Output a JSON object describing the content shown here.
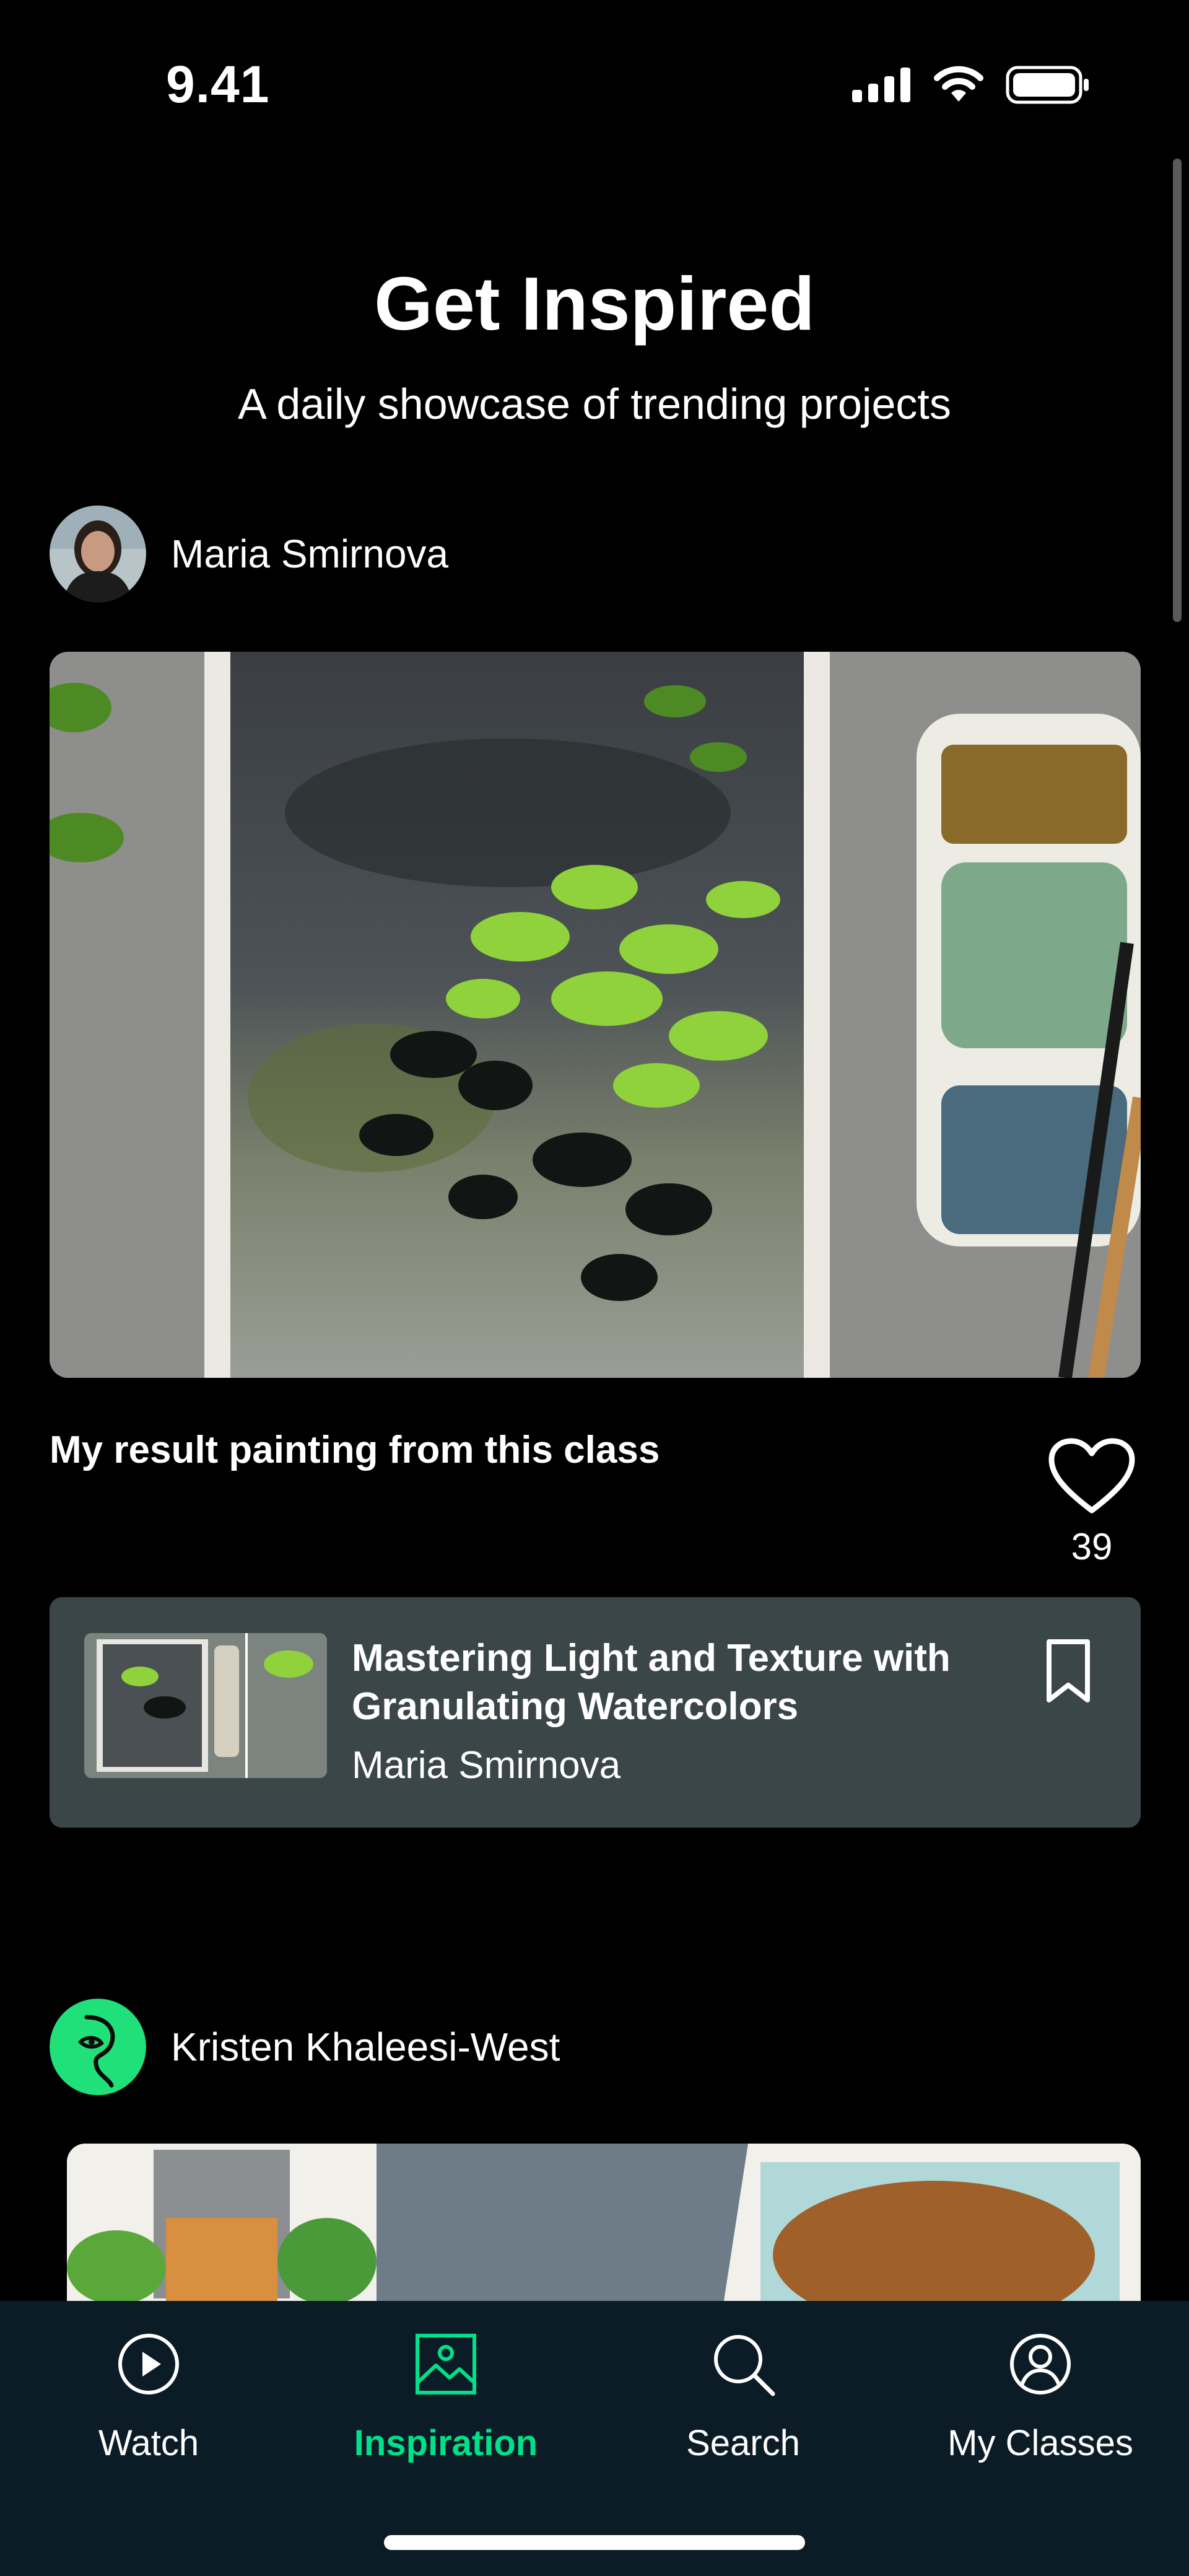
{
  "status_bar": {
    "time": "9.41"
  },
  "header": {
    "title": "Get Inspired",
    "subtitle": "A daily showcase of trending projects"
  },
  "posts": [
    {
      "author": "Maria Smirnova",
      "caption": "My result painting from this class",
      "likes": "39",
      "class": {
        "title": "Mastering Light and Texture with Granulating Watercolors",
        "teacher": "Maria Smirnova"
      }
    },
    {
      "author": "Kristen Khaleesi-West"
    }
  ],
  "tab_bar": {
    "tabs": [
      {
        "label": "Watch",
        "icon": "play-circle-icon",
        "active": false
      },
      {
        "label": "Inspiration",
        "icon": "image-icon",
        "active": true
      },
      {
        "label": "Search",
        "icon": "search-icon",
        "active": false
      },
      {
        "label": "My Classes",
        "icon": "user-circle-icon",
        "active": false
      }
    ]
  },
  "colors": {
    "background": "#000000",
    "accent": "#00e08a",
    "card": "#3a4647",
    "tab_bar": "#0c1c26"
  }
}
